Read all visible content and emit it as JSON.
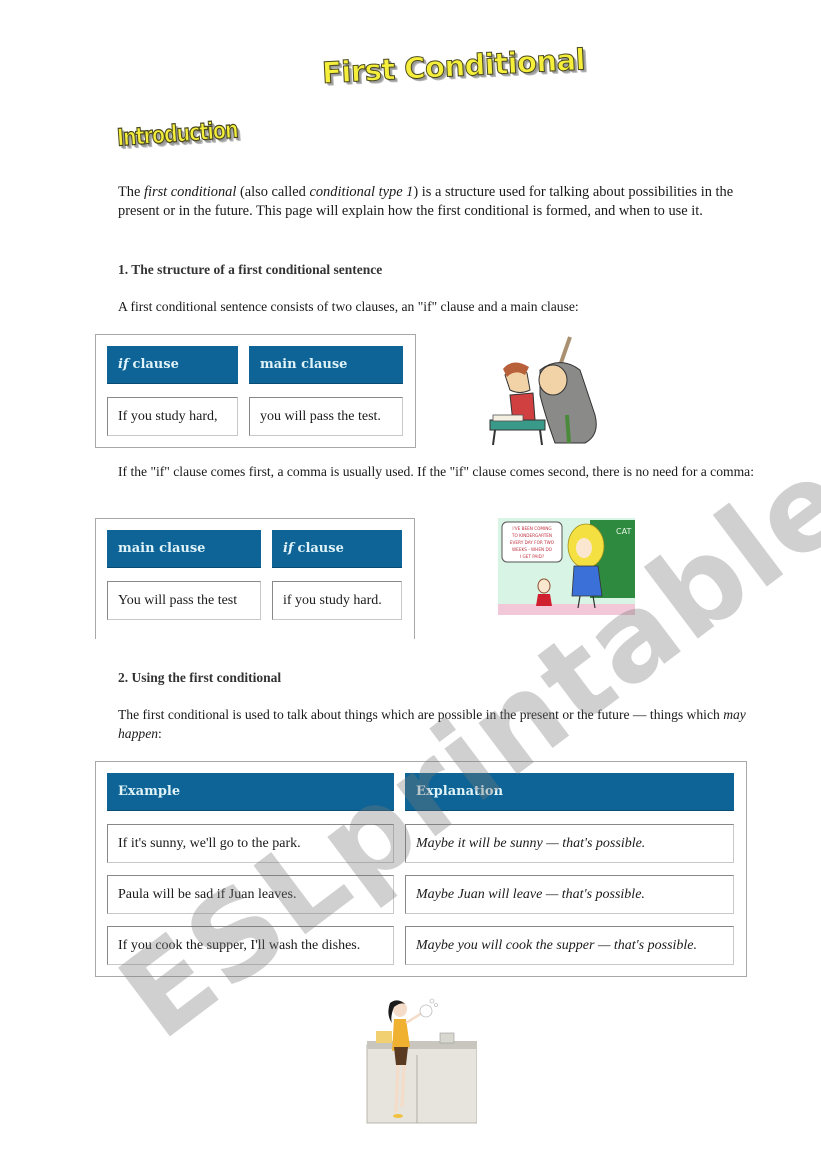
{
  "title": "First Conditional",
  "intro": {
    "heading": "Introduction",
    "text_parts": {
      "p1": "The ",
      "i1": "first conditional",
      "p2": " (also called ",
      "i2": "conditional type 1",
      "p3": ") is a structure used for talking about possibilities in the present or in the future. This page will explain how the first conditional is formed, and when to use it."
    }
  },
  "section1": {
    "heading": "1. The structure of a first conditional sentence",
    "text": "A first conditional sentence consists of two clauses, an \"if\" clause and a main clause:",
    "table1": {
      "headers": [
        {
          "italic": "if",
          "rest": "clause"
        },
        {
          "italic": "",
          "rest": "main clause"
        }
      ],
      "row": [
        "If you study hard,",
        "you will pass the test."
      ]
    },
    "comma_note": "If the \"if\" clause comes first, a comma is usually used. If the \"if\" clause comes second, there is no need for a comma:",
    "table2": {
      "headers": [
        {
          "italic": "",
          "rest": "main clause"
        },
        {
          "italic": "if",
          "rest": "clause"
        }
      ],
      "row": [
        "You will pass the test",
        "if you study hard."
      ]
    },
    "image1": "teacher-scolding-student-cartoon",
    "image2": {
      "description": "kindergarten-cartoon",
      "speech": "I'VE BEEN COMING TO KINDERGARTEN EVERY DAY FOR TWO WEEKS - WHEN DO I GET PAID?",
      "board": "CAT"
    }
  },
  "section2": {
    "heading": "2. Using the first conditional",
    "text_parts": {
      "p1": "The first conditional is used to talk about things which are possible in the present or the future — things which ",
      "i1": "may happen",
      "p2": ":"
    },
    "table": {
      "headers": [
        "Example",
        "Explanation"
      ],
      "rows": [
        [
          "If it's sunny, we'll go to the park.",
          "Maybe it will be sunny — that's possible."
        ],
        [
          "Paula will be sad if Juan leaves.",
          "Maybe Juan will leave — that's possible."
        ],
        [
          "If you cook the supper, I'll wash the dishes.",
          "Maybe you will cook the supper — that's possible."
        ]
      ]
    },
    "image3": "woman-washing-dishes-illustration"
  },
  "watermark": "ESLprintables.com"
}
